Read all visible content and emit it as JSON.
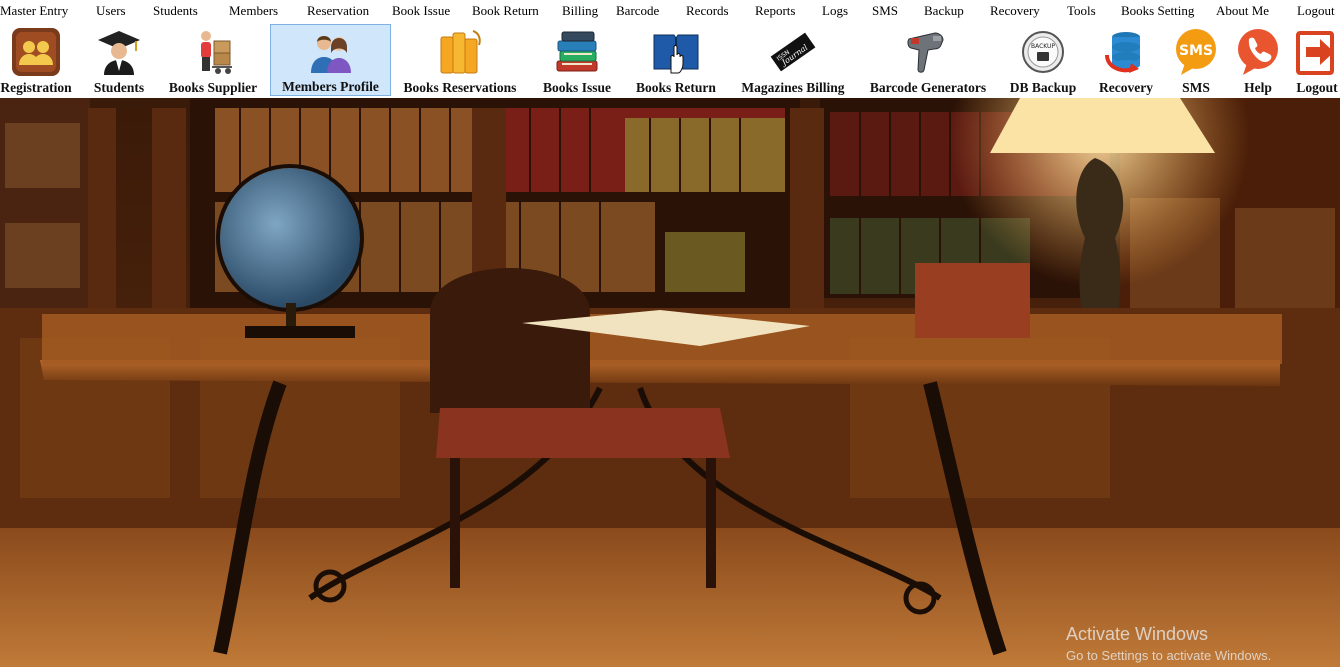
{
  "menu": [
    {
      "label": "Master Entry"
    },
    {
      "label": "Users"
    },
    {
      "label": "Students"
    },
    {
      "label": "Members"
    },
    {
      "label": "Reservation"
    },
    {
      "label": "Book Issue"
    },
    {
      "label": "Book Return"
    },
    {
      "label": "Billing"
    },
    {
      "label": "Barcode"
    },
    {
      "label": "Records"
    },
    {
      "label": "Reports"
    },
    {
      "label": "Logs"
    },
    {
      "label": "SMS"
    },
    {
      "label": "Backup"
    },
    {
      "label": "Recovery"
    },
    {
      "label": "Tools"
    },
    {
      "label": "Books Setting"
    },
    {
      "label": "About Me"
    },
    {
      "label": "Logout"
    }
  ],
  "toolbar": [
    {
      "label": "Registration",
      "icon": "registration-icon"
    },
    {
      "label": "Students",
      "icon": "graduate-icon"
    },
    {
      "label": "Books Supplier",
      "icon": "delivery-man-icon"
    },
    {
      "label": "Members Profile",
      "icon": "members-icon",
      "active": true
    },
    {
      "label": "Books Reservations",
      "icon": "books-folder-icon"
    },
    {
      "label": "Books Issue",
      "icon": "book-stack-icon"
    },
    {
      "label": "Books Return",
      "icon": "book-return-icon"
    },
    {
      "label": "Magazines Billing",
      "icon": "journal-icon",
      "icon_text": "Journal",
      "icon_text2": "ISSN"
    },
    {
      "label": "Barcode Generators",
      "icon": "barcode-scanner-icon"
    },
    {
      "label": "DB Backup",
      "icon": "backup-icon",
      "icon_text": "BACKUP"
    },
    {
      "label": "Recovery",
      "icon": "database-recovery-icon"
    },
    {
      "label": "SMS",
      "icon": "sms-icon",
      "icon_text": "SMS"
    },
    {
      "label": "Help",
      "icon": "phone-help-icon"
    },
    {
      "label": "Logout",
      "icon": "logout-icon"
    }
  ],
  "watermark": {
    "title": "Activate Windows",
    "subtitle": "Go to Settings to activate Windows."
  },
  "colors": {
    "active_bg": "#cfe6fb",
    "active_border": "#7fb2e4",
    "sms_orange": "#f39c12",
    "logout_red": "#d9431f"
  }
}
